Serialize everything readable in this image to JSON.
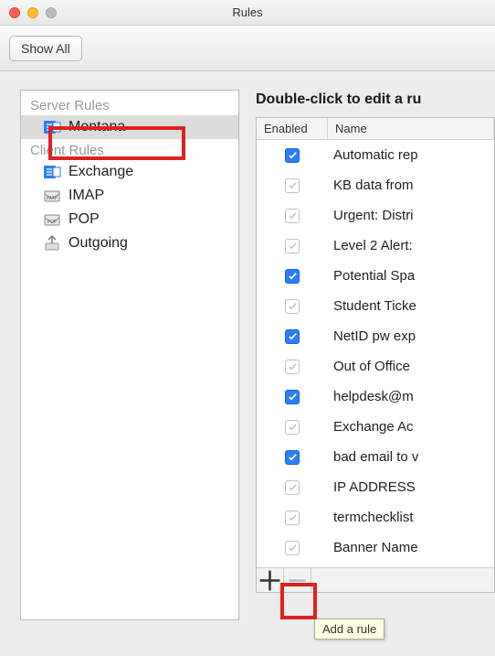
{
  "window": {
    "title": "Rules"
  },
  "toolbar": {
    "show_all": "Show All"
  },
  "sidebar": {
    "server_header": "Server Rules",
    "client_header": "Client Rules",
    "server_items": [
      {
        "label": "Montana",
        "icon": "exchange-icon",
        "selected": true
      }
    ],
    "client_items": [
      {
        "label": "Exchange",
        "icon": "exchange-icon"
      },
      {
        "label": "IMAP",
        "icon": "imap-icon"
      },
      {
        "label": "POP",
        "icon": "pop-icon"
      },
      {
        "label": "Outgoing",
        "icon": "outgoing-icon"
      }
    ]
  },
  "main": {
    "instruction": "Double-click to edit a ru",
    "columns": {
      "enabled": "Enabled",
      "name": "Name"
    },
    "rules": [
      {
        "enabled": true,
        "name": "Automatic rep"
      },
      {
        "enabled": false,
        "name": "KB data from"
      },
      {
        "enabled": false,
        "name": "Urgent: Distri"
      },
      {
        "enabled": false,
        "name": "Level 2 Alert:"
      },
      {
        "enabled": true,
        "name": "Potential Spa"
      },
      {
        "enabled": false,
        "name": "Student Ticke"
      },
      {
        "enabled": true,
        "name": "NetID pw exp"
      },
      {
        "enabled": false,
        "name": "Out of Office"
      },
      {
        "enabled": true,
        "name": "helpdesk@m"
      },
      {
        "enabled": false,
        "name": "Exchange Ac"
      },
      {
        "enabled": true,
        "name": "bad email to v"
      },
      {
        "enabled": false,
        "name": "IP ADDRESS"
      },
      {
        "enabled": false,
        "name": "termchecklist"
      },
      {
        "enabled": false,
        "name": "Banner Name"
      }
    ],
    "tooltip": "Add a rule"
  }
}
